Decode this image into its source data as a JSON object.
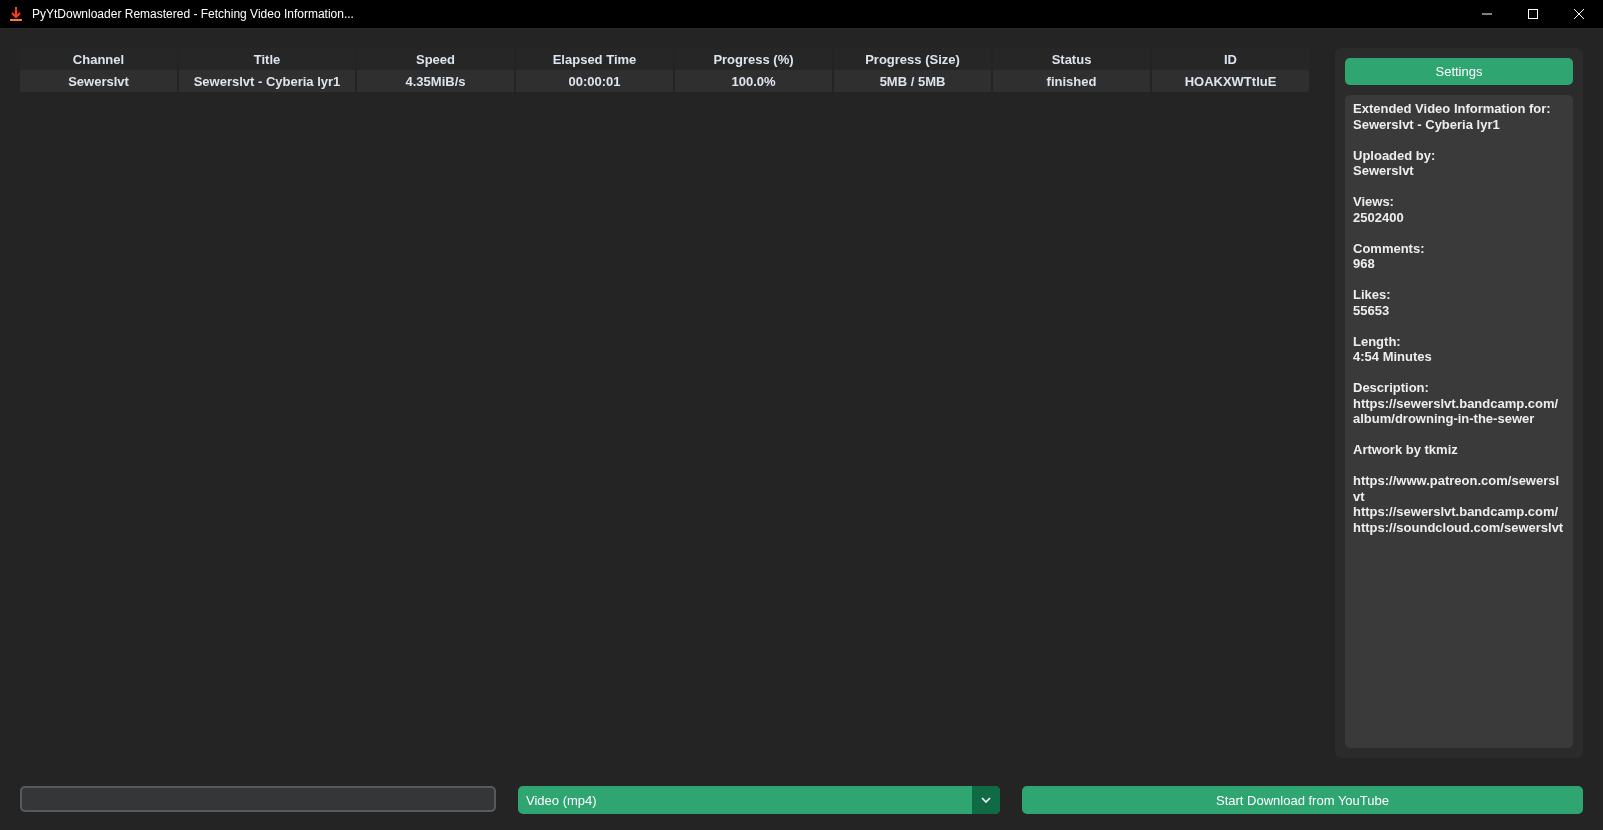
{
  "window": {
    "title": "PyYtDownloader Remastered - Fetching Video Information..."
  },
  "table": {
    "columns": [
      "Channel",
      "Title",
      "Speed",
      "Elapsed Time",
      "Progress (%)",
      "Progress (Size)",
      "Status",
      "ID"
    ],
    "rows": [
      {
        "cells": [
          "Sewerslvt",
          "Sewerslvt - Cyberia lyr1",
          "4.35MiB/s",
          "00:00:01",
          "100.0%",
          "5MB / 5MB",
          "finished",
          "HOAKXWTtluE"
        ]
      }
    ]
  },
  "sidebar": {
    "settings_button": "Settings",
    "info_paragraphs": [
      [
        "Extended Video Information for:",
        "Sewerslvt - Cyberia lyr1"
      ],
      [
        "Uploaded by:",
        "Sewerslvt"
      ],
      [
        "Views:",
        "2502400"
      ],
      [
        "Comments:",
        "968"
      ],
      [
        "Likes:",
        "55653"
      ],
      [
        "Length:",
        "4:54 Minutes"
      ],
      [
        "Description:",
        "https://sewerslvt.bandcamp.com/",
        "album/drowning-in-the-sewer"
      ],
      [
        "Artwork by tkmiz"
      ],
      [
        "https://www.patreon.com/sewersl",
        "vt",
        "https://sewerslvt.bandcamp.com/",
        "https://soundcloud.com/sewerslvt"
      ]
    ]
  },
  "bottom": {
    "format_dropdown": "Video (mp4)",
    "download_button": "Start Download from YouTube"
  }
}
